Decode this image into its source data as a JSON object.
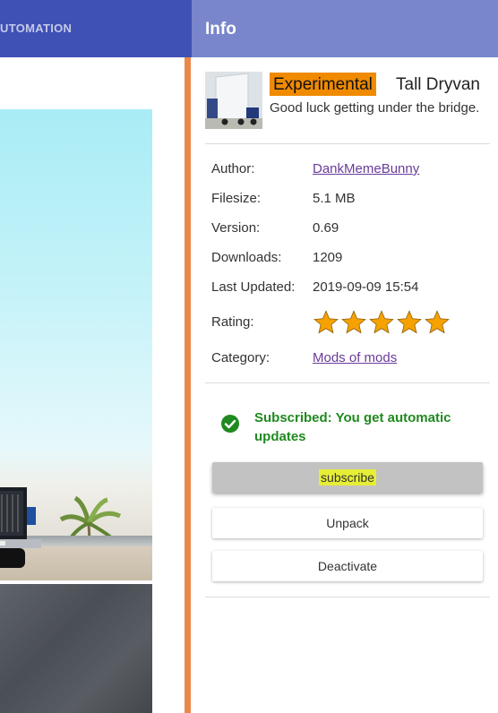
{
  "left": {
    "tab_label": "UTOMATION"
  },
  "info_panel": {
    "title": "Info",
    "mod": {
      "badge": "Experimental",
      "name": "Tall Dryvan",
      "description": "Good luck getting under the bridge."
    },
    "details": [
      {
        "label": "Author:",
        "value": "DankMemeBunny",
        "link": true
      },
      {
        "label": "Filesize:",
        "value": "5.1 MB",
        "link": false
      },
      {
        "label": "Version:",
        "value": "0.69",
        "link": false
      },
      {
        "label": "Downloads:",
        "value": "1209",
        "link": false
      },
      {
        "label": "Last Updated:",
        "value": "2019-09-09 15:54",
        "link": false
      }
    ],
    "rating": {
      "label": "Rating:",
      "stars": 5,
      "max": 5
    },
    "category": {
      "label": "Category:",
      "value": "Mods of mods"
    },
    "status": {
      "text": "Subscribed: You get automatic updates",
      "color": "#1f8a1f"
    },
    "buttons": {
      "subscribe": "subscribe",
      "unpack": "Unpack",
      "deactivate": "Deactivate"
    }
  },
  "colors": {
    "left_header": "#3f51b5",
    "right_header": "#7986cb",
    "accent_strip": "#e8894a",
    "badge": "#f08a00",
    "star": "#f5a100",
    "link": "#6a3b9a"
  }
}
